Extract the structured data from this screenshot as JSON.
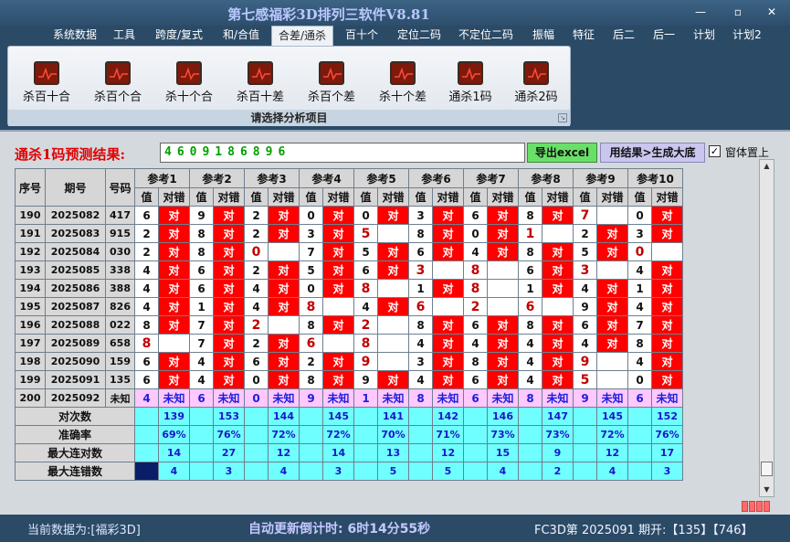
{
  "app": {
    "title": "第七感福彩3D排列三软件V8.81",
    "window_buttons": {
      "minimize": "—",
      "restore": "▫",
      "close": "✕"
    }
  },
  "menu": [
    "系统数据",
    "工具",
    "跨度/复式",
    "和/合值",
    "合差/通杀",
    "百十个",
    "定位二码",
    "不定位二码",
    "振幅",
    "特征",
    "后二",
    "后一",
    "计划",
    "计划2"
  ],
  "ribbon": {
    "tools": [
      "杀百十合",
      "杀百个合",
      "杀十个合",
      "杀百十差",
      "杀百个差",
      "杀十个差",
      "通杀1码",
      "通杀2码"
    ],
    "caption": "请选择分析项目"
  },
  "prediction": {
    "label": "通杀1码预测结果:",
    "value": "4609186896",
    "export_button": "导出excel",
    "generate_button": "用结果>生成大底",
    "checkbox_label": "窗体置上",
    "checkbox_checked": "✓"
  },
  "table": {
    "headers": {
      "seq": "序号",
      "issue": "期号",
      "code": "号码",
      "refs": [
        "参考1",
        "参考2",
        "参考3",
        "参考4",
        "参考5",
        "参考6",
        "参考7",
        "参考8",
        "参考9",
        "参考10"
      ],
      "value": "值",
      "hit": "对错"
    },
    "ok_text": "对",
    "rows": [
      {
        "seq": "190",
        "issue": "2025082",
        "code": "417",
        "vals": [
          "6",
          "9",
          "2",
          "0",
          "0",
          "3",
          "6",
          "8",
          "7",
          "0"
        ],
        "hits": [
          1,
          1,
          1,
          1,
          1,
          1,
          1,
          1,
          0,
          1
        ]
      },
      {
        "seq": "191",
        "issue": "2025083",
        "code": "915",
        "vals": [
          "2",
          "8",
          "2",
          "3",
          "5",
          "8",
          "0",
          "1",
          "2",
          "3"
        ],
        "hits": [
          1,
          1,
          1,
          1,
          0,
          1,
          1,
          0,
          1,
          1
        ]
      },
      {
        "seq": "192",
        "issue": "2025084",
        "code": "030",
        "vals": [
          "2",
          "8",
          "0",
          "7",
          "5",
          "6",
          "4",
          "8",
          "5",
          "0"
        ],
        "hits": [
          1,
          1,
          0,
          1,
          1,
          1,
          1,
          1,
          1,
          0
        ]
      },
      {
        "seq": "193",
        "issue": "2025085",
        "code": "338",
        "vals": [
          "4",
          "6",
          "2",
          "5",
          "6",
          "3",
          "8",
          "6",
          "3",
          "4"
        ],
        "hits": [
          1,
          1,
          1,
          1,
          1,
          0,
          0,
          1,
          0,
          1
        ]
      },
      {
        "seq": "194",
        "issue": "2025086",
        "code": "388",
        "vals": [
          "4",
          "6",
          "4",
          "0",
          "8",
          "1",
          "8",
          "1",
          "4",
          "1"
        ],
        "hits": [
          1,
          1,
          1,
          1,
          0,
          1,
          0,
          1,
          1,
          1
        ]
      },
      {
        "seq": "195",
        "issue": "2025087",
        "code": "826",
        "vals": [
          "4",
          "1",
          "4",
          "8",
          "4",
          "6",
          "2",
          "6",
          "9",
          "4"
        ],
        "hits": [
          1,
          1,
          1,
          0,
          1,
          0,
          0,
          0,
          1,
          1
        ]
      },
      {
        "seq": "196",
        "issue": "2025088",
        "code": "022",
        "vals": [
          "8",
          "7",
          "2",
          "8",
          "2",
          "8",
          "6",
          "8",
          "6",
          "7"
        ],
        "hits": [
          1,
          1,
          0,
          1,
          0,
          1,
          1,
          1,
          1,
          1
        ]
      },
      {
        "seq": "197",
        "issue": "2025089",
        "code": "658",
        "vals": [
          "8",
          "7",
          "2",
          "6",
          "8",
          "4",
          "4",
          "4",
          "4",
          "8"
        ],
        "hits": [
          0,
          1,
          1,
          0,
          0,
          1,
          1,
          1,
          1,
          1
        ]
      },
      {
        "seq": "198",
        "issue": "2025090",
        "code": "159",
        "vals": [
          "6",
          "4",
          "6",
          "2",
          "9",
          "3",
          "8",
          "4",
          "9",
          "4"
        ],
        "hits": [
          1,
          1,
          1,
          1,
          0,
          1,
          1,
          1,
          0,
          1
        ]
      },
      {
        "seq": "199",
        "issue": "2025091",
        "code": "135",
        "vals": [
          "6",
          "4",
          "0",
          "8",
          "9",
          "4",
          "6",
          "4",
          "5",
          "0"
        ],
        "hits": [
          1,
          1,
          1,
          1,
          1,
          1,
          1,
          1,
          0,
          1
        ]
      }
    ],
    "pending": {
      "seq": "200",
      "issue": "2025092",
      "code": "未知",
      "vals": [
        "4",
        "6",
        "0",
        "9",
        "1",
        "8",
        "6",
        "8",
        "9",
        "6"
      ],
      "unknown": "未知"
    },
    "stats": [
      {
        "label": "对次数",
        "values": [
          "139",
          "153",
          "144",
          "145",
          "141",
          "142",
          "146",
          "147",
          "145",
          "152"
        ]
      },
      {
        "label": "准确率",
        "values": [
          "69%",
          "76%",
          "72%",
          "72%",
          "70%",
          "71%",
          "73%",
          "73%",
          "72%",
          "76%"
        ]
      },
      {
        "label": "最大连对数",
        "values": [
          "14",
          "27",
          "12",
          "14",
          "13",
          "12",
          "15",
          "9",
          "12",
          "17"
        ]
      },
      {
        "label": "最大连错数",
        "values": [
          "4",
          "3",
          "4",
          "3",
          "5",
          "5",
          "4",
          "2",
          "4",
          "3"
        ]
      }
    ]
  },
  "status": {
    "current_data": "当前数据为:[福彩3D]",
    "countdown": "自动更新倒计时: 6时14分55秒",
    "latest": "FC3D第 2025091 期开:【135】【746】"
  },
  "colors": {
    "hit_red": "#ff0000",
    "pending_pink": "#ffc8ff",
    "stats_cyan": "#6fffff",
    "prediction_green": "#00a000",
    "prediction_label_red": "#e00000"
  }
}
